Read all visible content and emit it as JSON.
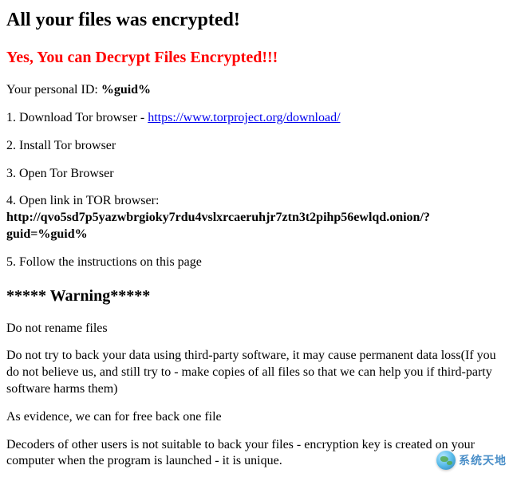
{
  "title": "All your files was encrypted!",
  "subtitle": "Yes, You can Decrypt Files Encrypted!!!",
  "personal_id_line_prefix": "Your personal ID: ",
  "personal_id_value": "%guid%",
  "step1_prefix": "1. Download Tor browser - ",
  "step1_link_text": "https://www.torproject.org/download/",
  "step1_link_href": "https://www.torproject.org/download/",
  "step2": "2. Install Tor browser",
  "step3": "3. Open Tor Browser",
  "step4_intro": "4. Open link in TOR browser:",
  "step4_url": "http://qvo5sd7p5yazwbrgioky7rdu4vslxrcaeruhjr7ztn3t2pihp56ewlqd.onion/?guid=%guid%",
  "step5": "5. Follow the instructions on this page",
  "warning_header": "***** Warning*****",
  "warn_line1": "Do not rename files",
  "warn_line2": "Do not try to back your data using third-party software, it may cause permanent data loss(If you do not believe us, and still try to - make copies of all files so that we can help you if third-party software harms them)",
  "warn_line3": "As evidence, we can for free back one file",
  "warn_line4": "Decoders of other users is not suitable to back your files - encryption key is created on your computer when the program is launched - it is unique.",
  "watermark_text": "系统天地"
}
